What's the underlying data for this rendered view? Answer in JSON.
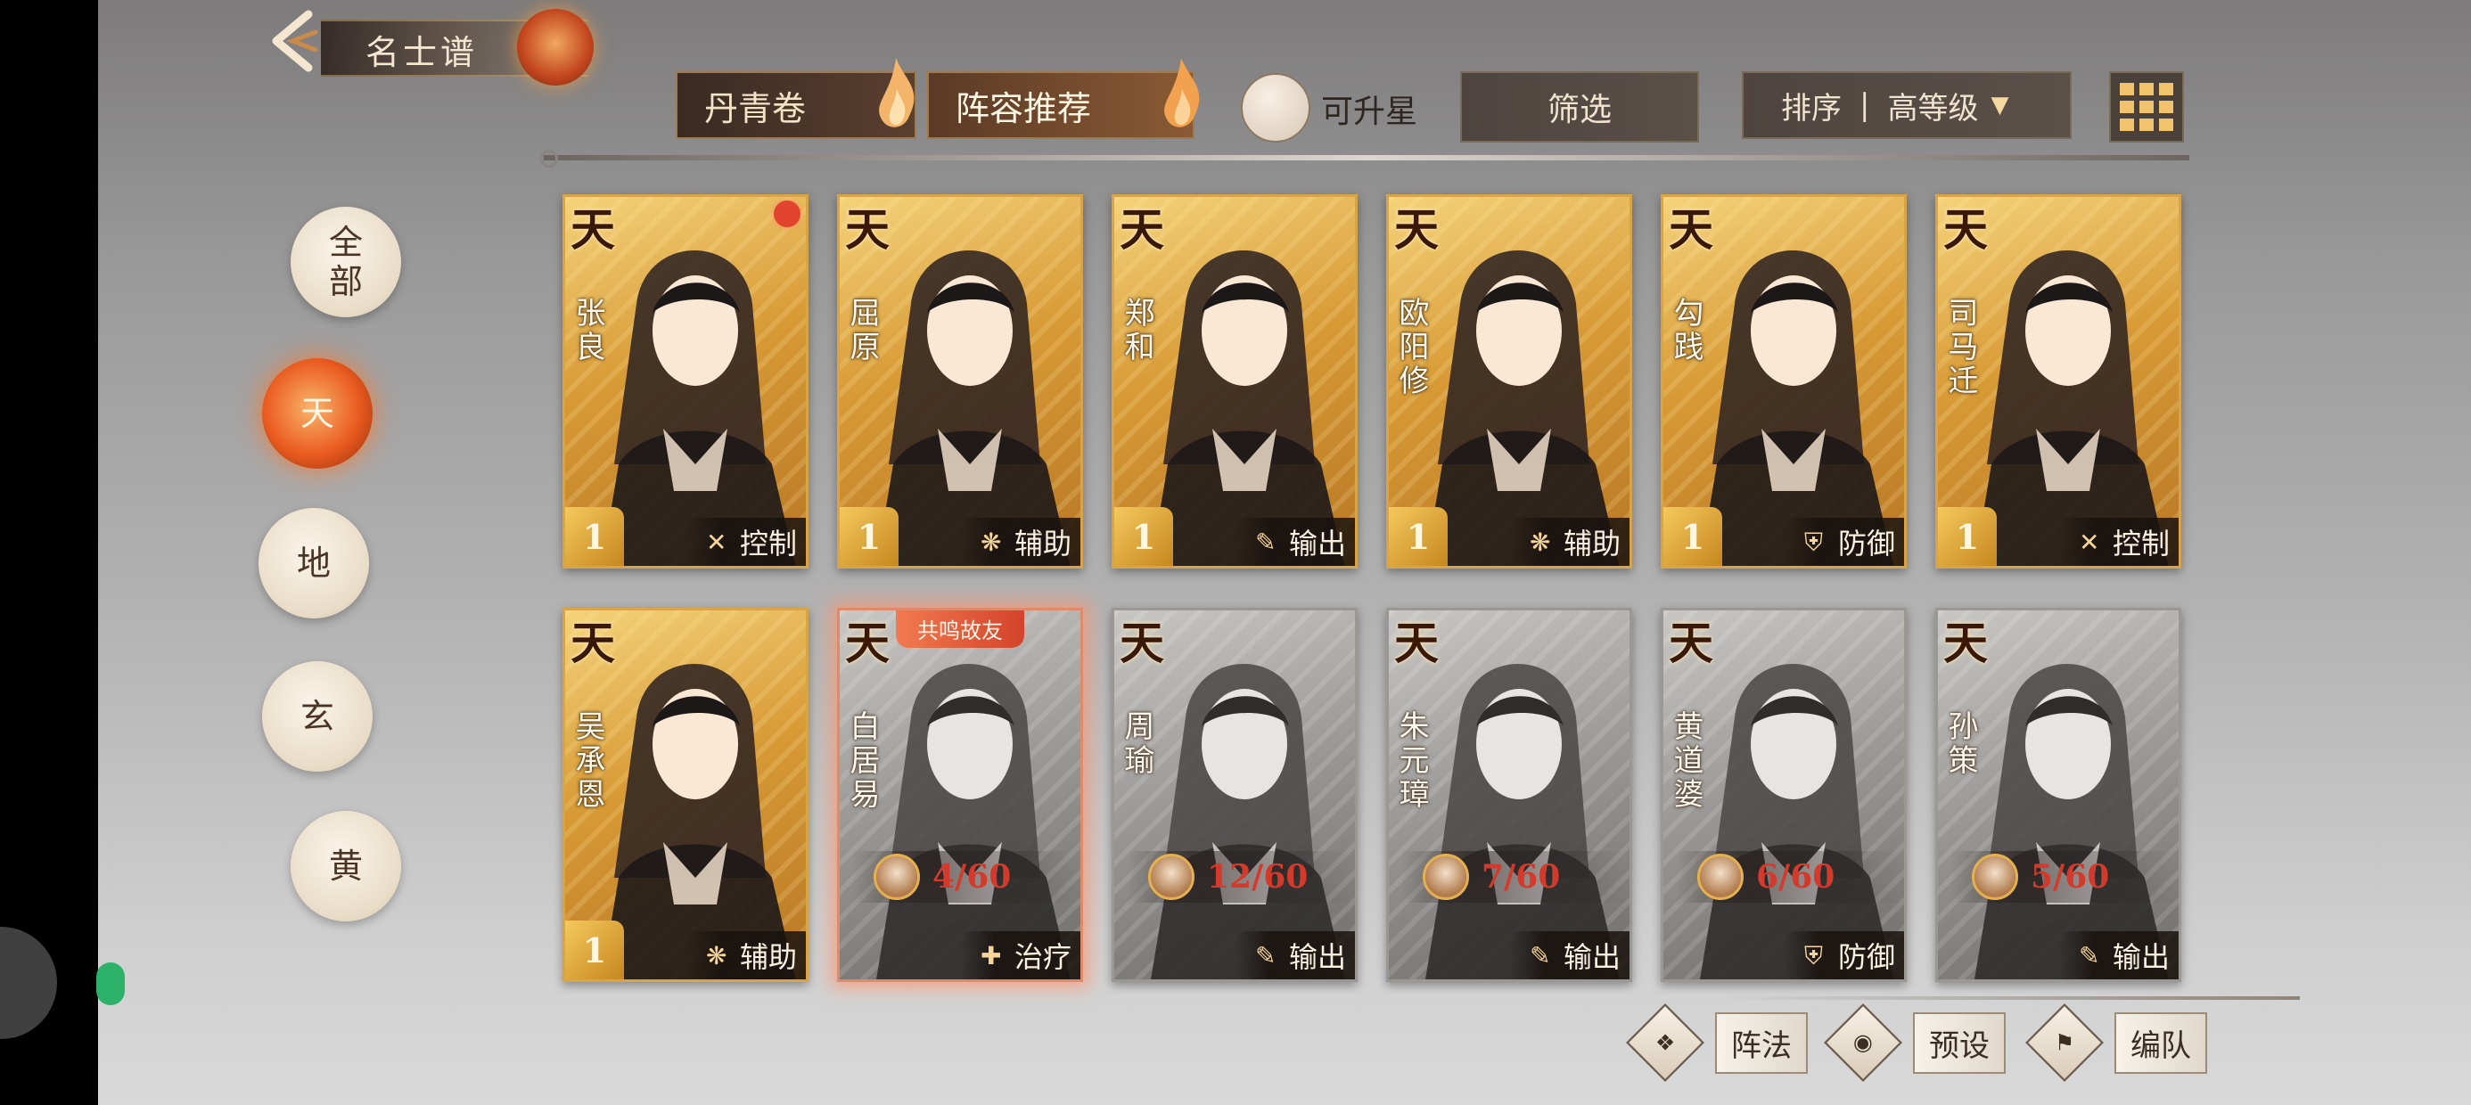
{
  "header": {
    "title": "名士谱"
  },
  "toolbar": {
    "tab_danqing": "丹青卷",
    "tab_recommend": "阵容推荐",
    "upgrade_label": "可升星",
    "filter_label": "筛选",
    "sort_label": "排序",
    "sort_separator": "|",
    "sort_value": "高等级"
  },
  "ranks": [
    {
      "label": "全\n部",
      "active": false
    },
    {
      "label": "天",
      "active": true
    },
    {
      "label": "地",
      "active": false
    },
    {
      "label": "玄",
      "active": false
    },
    {
      "label": "黄",
      "active": false
    }
  ],
  "cards": [
    {
      "rank": "天",
      "name": "张良",
      "star": "1",
      "role": "控制",
      "role_icon": "control-icon",
      "style": "color",
      "dot": true
    },
    {
      "rank": "天",
      "name": "屈原",
      "star": "1",
      "role": "辅助",
      "role_icon": "support-icon",
      "style": "color"
    },
    {
      "rank": "天",
      "name": "郑和",
      "star": "1",
      "role": "输出",
      "role_icon": "attack-icon",
      "style": "color"
    },
    {
      "rank": "天",
      "name": "欧阳修",
      "star": "1",
      "role": "辅助",
      "role_icon": "support-icon",
      "style": "color"
    },
    {
      "rank": "天",
      "name": "勾践",
      "star": "1",
      "role": "防御",
      "role_icon": "shield-icon",
      "style": "color"
    },
    {
      "rank": "天",
      "name": "司马迁",
      "star": "1",
      "role": "控制",
      "role_icon": "control-icon",
      "style": "color"
    },
    {
      "rank": "天",
      "name": "吴承恩",
      "star": "1",
      "role": "辅助",
      "role_icon": "support-icon",
      "style": "color"
    },
    {
      "rank": "天",
      "name": "白居易",
      "shards": "4/60",
      "role": "治疗",
      "role_icon": "heal-icon",
      "style": "gray",
      "tag": "共鸣故友",
      "glow": true
    },
    {
      "rank": "天",
      "name": "周瑜",
      "shards": "12/60",
      "role": "输出",
      "role_icon": "attack-icon",
      "style": "gray"
    },
    {
      "rank": "天",
      "name": "朱元璋",
      "shards": "7/60",
      "role": "输出",
      "role_icon": "attack-icon",
      "style": "gray"
    },
    {
      "rank": "天",
      "name": "黄道婆",
      "shards": "6/60",
      "role": "防御",
      "role_icon": "shield-icon",
      "style": "gray"
    },
    {
      "rank": "天",
      "name": "孙策",
      "shards": "5/60",
      "role": "输出",
      "role_icon": "attack-icon",
      "style": "gray"
    }
  ],
  "bottom": {
    "formation": "阵法",
    "preset": "预设",
    "team": "编队"
  },
  "colors": {
    "accent": "#d8a447",
    "active_rank": "#ea5b1f",
    "shard_count": "#d43a2b"
  }
}
